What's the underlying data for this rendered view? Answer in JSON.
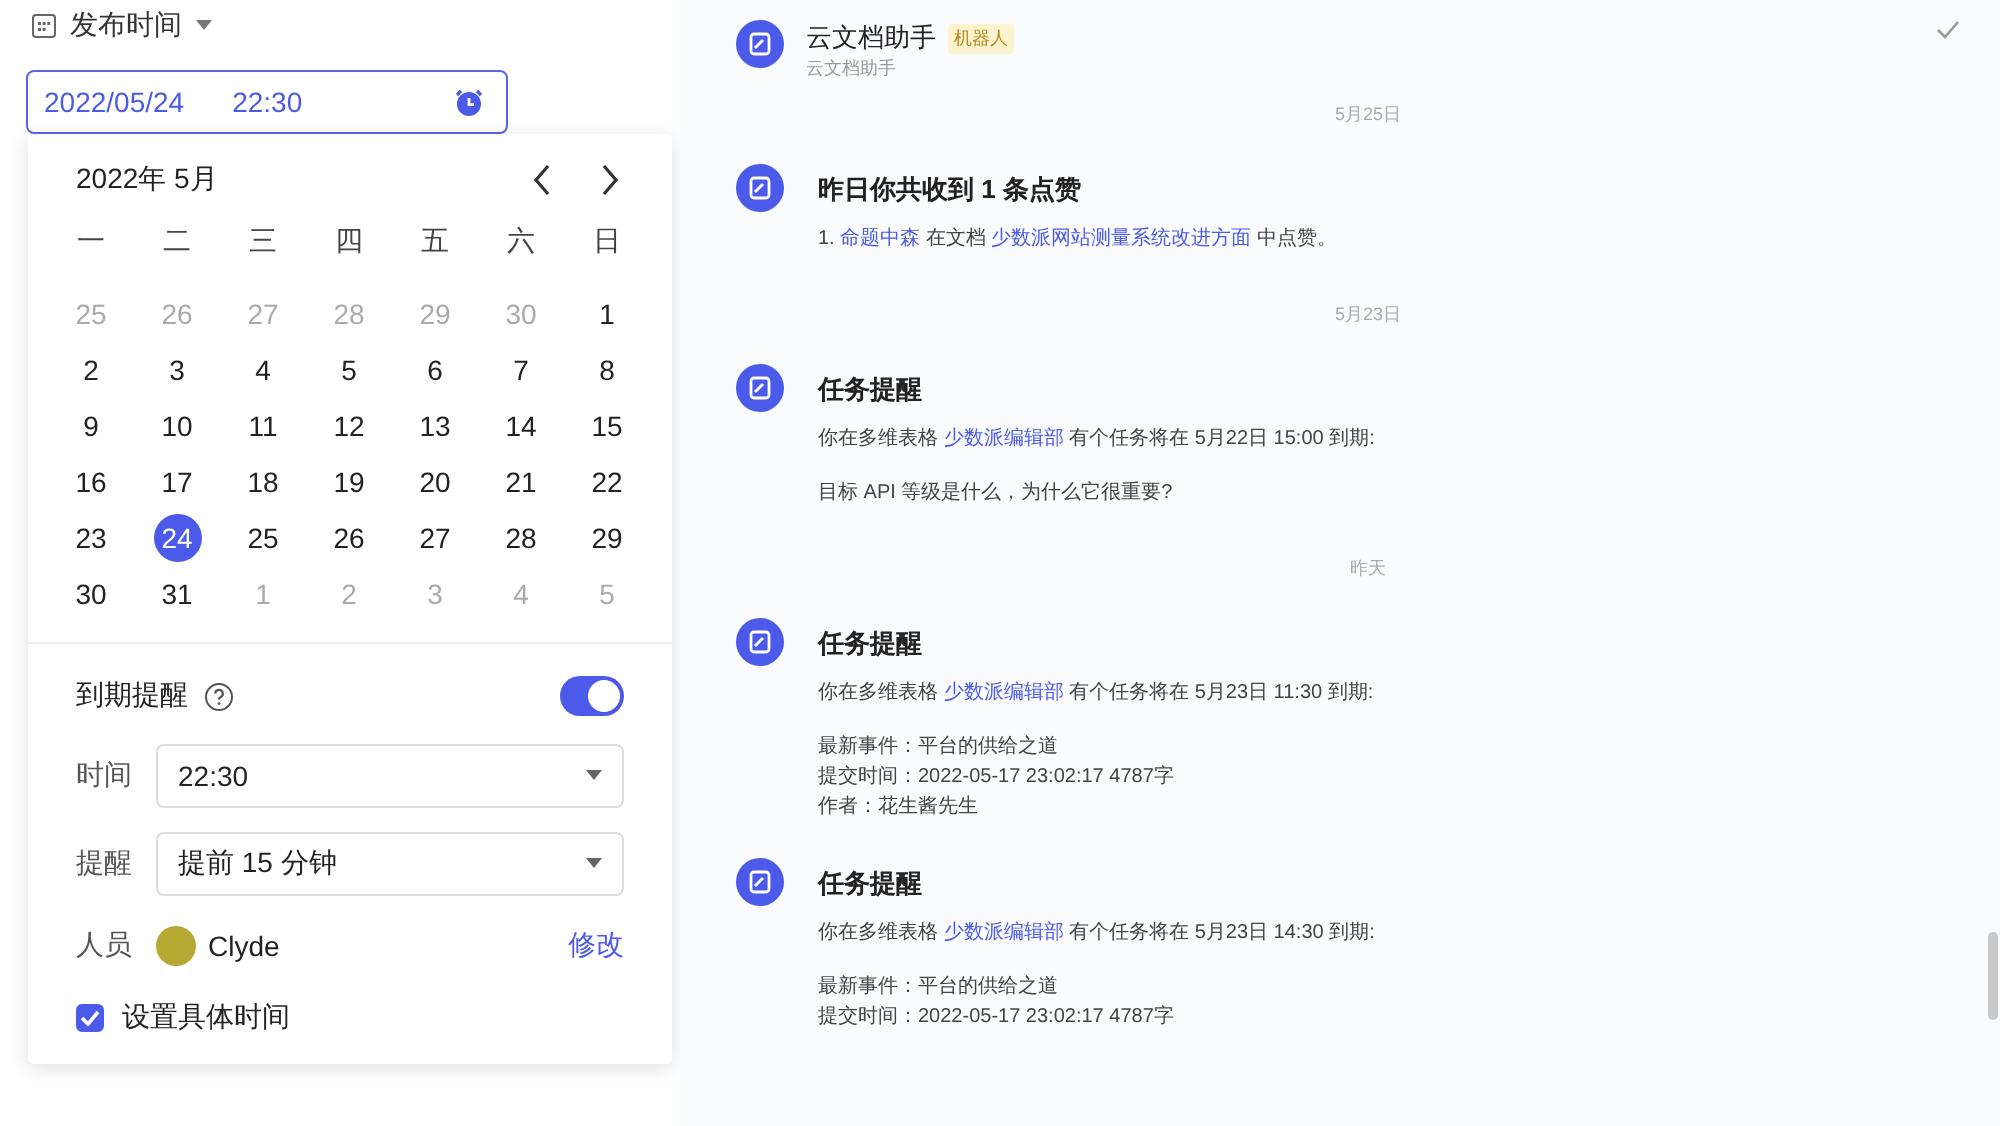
{
  "filter": {
    "label": "发布时间"
  },
  "date_field": {
    "date": "2022/05/24",
    "time": "22:30"
  },
  "calendar": {
    "title": "2022年 5月",
    "weekdays": [
      "一",
      "二",
      "三",
      "四",
      "五",
      "六",
      "日"
    ],
    "days": [
      {
        "label": "25",
        "in_month": false,
        "selected": false
      },
      {
        "label": "26",
        "in_month": false,
        "selected": false
      },
      {
        "label": "27",
        "in_month": false,
        "selected": false
      },
      {
        "label": "28",
        "in_month": false,
        "selected": false
      },
      {
        "label": "29",
        "in_month": false,
        "selected": false
      },
      {
        "label": "30",
        "in_month": false,
        "selected": false
      },
      {
        "label": "1",
        "in_month": true,
        "selected": false
      },
      {
        "label": "2",
        "in_month": true,
        "selected": false
      },
      {
        "label": "3",
        "in_month": true,
        "selected": false
      },
      {
        "label": "4",
        "in_month": true,
        "selected": false
      },
      {
        "label": "5",
        "in_month": true,
        "selected": false
      },
      {
        "label": "6",
        "in_month": true,
        "selected": false
      },
      {
        "label": "7",
        "in_month": true,
        "selected": false
      },
      {
        "label": "8",
        "in_month": true,
        "selected": false
      },
      {
        "label": "9",
        "in_month": true,
        "selected": false
      },
      {
        "label": "10",
        "in_month": true,
        "selected": false
      },
      {
        "label": "11",
        "in_month": true,
        "selected": false
      },
      {
        "label": "12",
        "in_month": true,
        "selected": false
      },
      {
        "label": "13",
        "in_month": true,
        "selected": false
      },
      {
        "label": "14",
        "in_month": true,
        "selected": false
      },
      {
        "label": "15",
        "in_month": true,
        "selected": false
      },
      {
        "label": "16",
        "in_month": true,
        "selected": false
      },
      {
        "label": "17",
        "in_month": true,
        "selected": false
      },
      {
        "label": "18",
        "in_month": true,
        "selected": false
      },
      {
        "label": "19",
        "in_month": true,
        "selected": false
      },
      {
        "label": "20",
        "in_month": true,
        "selected": false
      },
      {
        "label": "21",
        "in_month": true,
        "selected": false
      },
      {
        "label": "22",
        "in_month": true,
        "selected": false
      },
      {
        "label": "23",
        "in_month": true,
        "selected": false
      },
      {
        "label": "24",
        "in_month": true,
        "selected": true
      },
      {
        "label": "25",
        "in_month": true,
        "selected": false
      },
      {
        "label": "26",
        "in_month": true,
        "selected": false
      },
      {
        "label": "27",
        "in_month": true,
        "selected": false
      },
      {
        "label": "28",
        "in_month": true,
        "selected": false
      },
      {
        "label": "29",
        "in_month": true,
        "selected": false
      },
      {
        "label": "30",
        "in_month": true,
        "selected": false
      },
      {
        "label": "31",
        "in_month": true,
        "selected": false
      },
      {
        "label": "1",
        "in_month": false,
        "selected": false
      },
      {
        "label": "2",
        "in_month": false,
        "selected": false
      },
      {
        "label": "3",
        "in_month": false,
        "selected": false
      },
      {
        "label": "4",
        "in_month": false,
        "selected": false
      },
      {
        "label": "5",
        "in_month": false,
        "selected": false
      }
    ]
  },
  "reminder": {
    "label": "到期提醒",
    "on": true,
    "time_label": "时间",
    "time_value": "22:30",
    "remind_label": "提醒",
    "remind_value": "提前 15 分钟",
    "person_label": "人员",
    "person_name": "Clyde",
    "edit_link": "修改",
    "specific_time": {
      "label": "设置具体时间",
      "checked": true
    }
  },
  "feed": [
    {
      "kind": "header",
      "sender": "云文档助手",
      "badge": "机器人",
      "subtitle": "云文档助手"
    },
    {
      "kind": "divider",
      "text": "5月25日"
    },
    {
      "kind": "message",
      "title": "昨日你共收到 1 条点赞",
      "paragraphs": [
        [
          [
            {
              "text": "1. ",
              "link": false
            },
            {
              "text": "命题中森",
              "link": true
            },
            {
              "text": " 在文档 ",
              "link": false
            },
            {
              "text": "少数派网站测量系统改进方面",
              "link": true
            },
            {
              "text": " 中点赞。",
              "link": false
            }
          ]
        ]
      ]
    },
    {
      "kind": "divider",
      "text": "5月23日"
    },
    {
      "kind": "message",
      "title": "任务提醒",
      "paragraphs": [
        [
          [
            {
              "text": "你在多维表格 ",
              "link": false
            },
            {
              "text": "少数派编辑部",
              "link": true
            },
            {
              "text": " 有个任务将在 5月22日 15:00 到期:",
              "link": false
            }
          ]
        ],
        [
          [
            {
              "text": "目标 API 等级是什么，为什么它很重要?",
              "link": false
            }
          ]
        ]
      ]
    },
    {
      "kind": "divider",
      "text": "昨天"
    },
    {
      "kind": "message",
      "title": "任务提醒",
      "paragraphs": [
        [
          [
            {
              "text": "你在多维表格 ",
              "link": false
            },
            {
              "text": "少数派编辑部",
              "link": true
            },
            {
              "text": " 有个任务将在 5月23日 11:30 到期:",
              "link": false
            }
          ]
        ],
        [
          [
            {
              "text": "最新事件：平台的供给之道",
              "link": false
            }
          ],
          [
            {
              "text": "提交时间：2022-05-17 23:02:17  4787字",
              "link": false
            }
          ],
          [
            {
              "text": "作者：花生酱先生",
              "link": false
            }
          ]
        ]
      ]
    },
    {
      "kind": "message",
      "title": "任务提醒",
      "paragraphs": [
        [
          [
            {
              "text": "你在多维表格 ",
              "link": false
            },
            {
              "text": "少数派编辑部",
              "link": true
            },
            {
              "text": " 有个任务将在 5月23日 14:30 到期:",
              "link": false
            }
          ]
        ],
        [
          [
            {
              "text": "最新事件：平台的供给之道",
              "link": false
            }
          ],
          [
            {
              "text": "提交时间：2022-05-17 23:02:17  4787字",
              "link": false
            }
          ]
        ]
      ]
    }
  ]
}
